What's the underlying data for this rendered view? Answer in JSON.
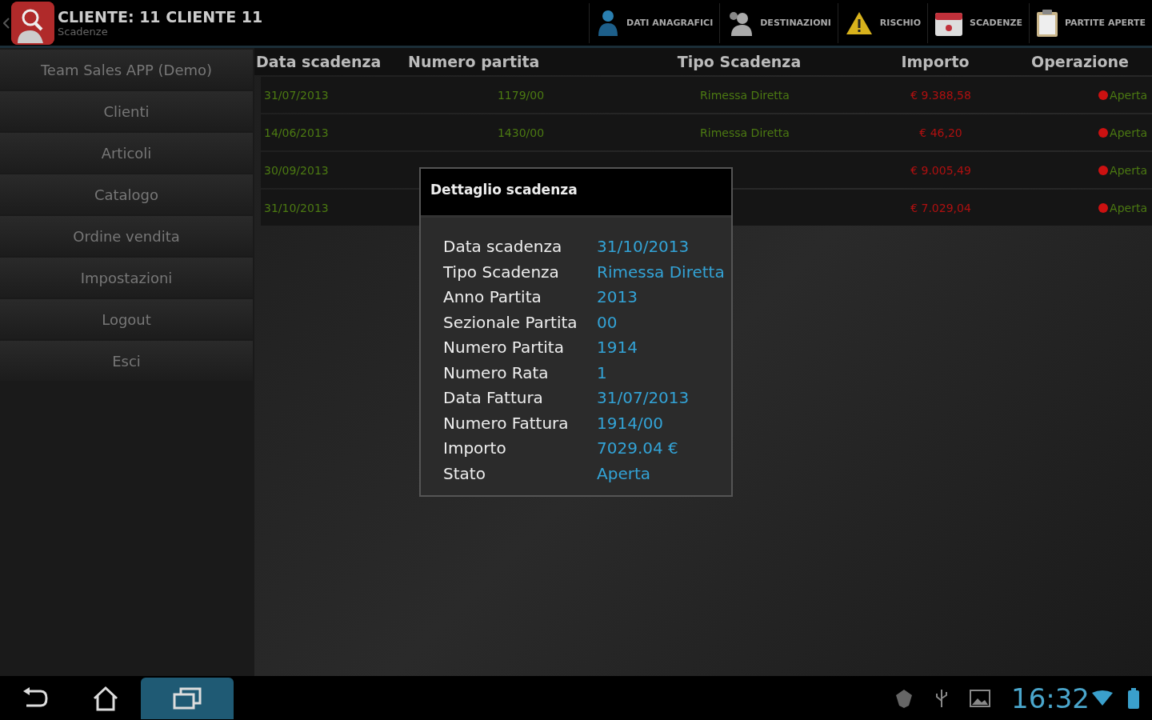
{
  "action_bar": {
    "title": "CLIENTE: 11 CLIENTE 11",
    "subtitle": "Scadenze",
    "actions": [
      {
        "kind": "person",
        "label": "DATI ANAGRAFICI"
      },
      {
        "kind": "people",
        "label": "DESTINAZIONI"
      },
      {
        "kind": "warning",
        "label": "RISCHIO"
      },
      {
        "kind": "calendar",
        "label": "SCADENZE"
      },
      {
        "kind": "clipboard",
        "label": "PARTITE APERTE"
      }
    ]
  },
  "sidebar": {
    "items": [
      {
        "label": "Team Sales APP (Demo)"
      },
      {
        "label": "Clienti"
      },
      {
        "label": "Articoli"
      },
      {
        "label": "Catalogo"
      },
      {
        "label": "Ordine vendita"
      },
      {
        "label": "Impostazioni"
      },
      {
        "label": "Logout"
      },
      {
        "label": "Esci"
      }
    ]
  },
  "table": {
    "columns": [
      "Data scadenza",
      "Numero partita",
      "Tipo Scadenza",
      "Importo",
      "Operazione"
    ],
    "rows": [
      {
        "date": "31/07/2013",
        "number": "1179/00",
        "type": "Rimessa Diretta",
        "amount": "€ 9.388,58",
        "status": "Aperta",
        "color": "#cc1111"
      },
      {
        "date": "14/06/2013",
        "number": "1430/00",
        "type": "Rimessa Diretta",
        "amount": "€ 46,20",
        "status": "Aperta",
        "color": "#cc1111"
      },
      {
        "date": "30/09/2013",
        "amount": "€ 9.005,49",
        "status": "Aperta",
        "color": "#cc1111"
      },
      {
        "date": "31/10/2013",
        "amount": "€ 7.029,04",
        "status": "Aperta",
        "color": "#cc1111"
      }
    ]
  },
  "dialog": {
    "title": "Dettaglio scadenza",
    "fields": [
      {
        "label": "Data scadenza",
        "value": "31/10/2013"
      },
      {
        "label": "Tipo Scadenza",
        "value": "Rimessa Diretta"
      },
      {
        "label": "Anno Partita",
        "value": "2013"
      },
      {
        "label": "Sezionale Partita",
        "value": "00"
      },
      {
        "label": "Numero Partita",
        "value": "1914"
      },
      {
        "label": "Numero Rata",
        "value": "1"
      },
      {
        "label": "Data Fattura",
        "value": "31/07/2013"
      },
      {
        "label": "Numero Fattura",
        "value": "1914/00"
      },
      {
        "label": "Importo",
        "value": "7029.04 €"
      },
      {
        "label": "Stato",
        "value": "Aperta"
      }
    ]
  },
  "status_bar": {
    "time": "16:32"
  }
}
